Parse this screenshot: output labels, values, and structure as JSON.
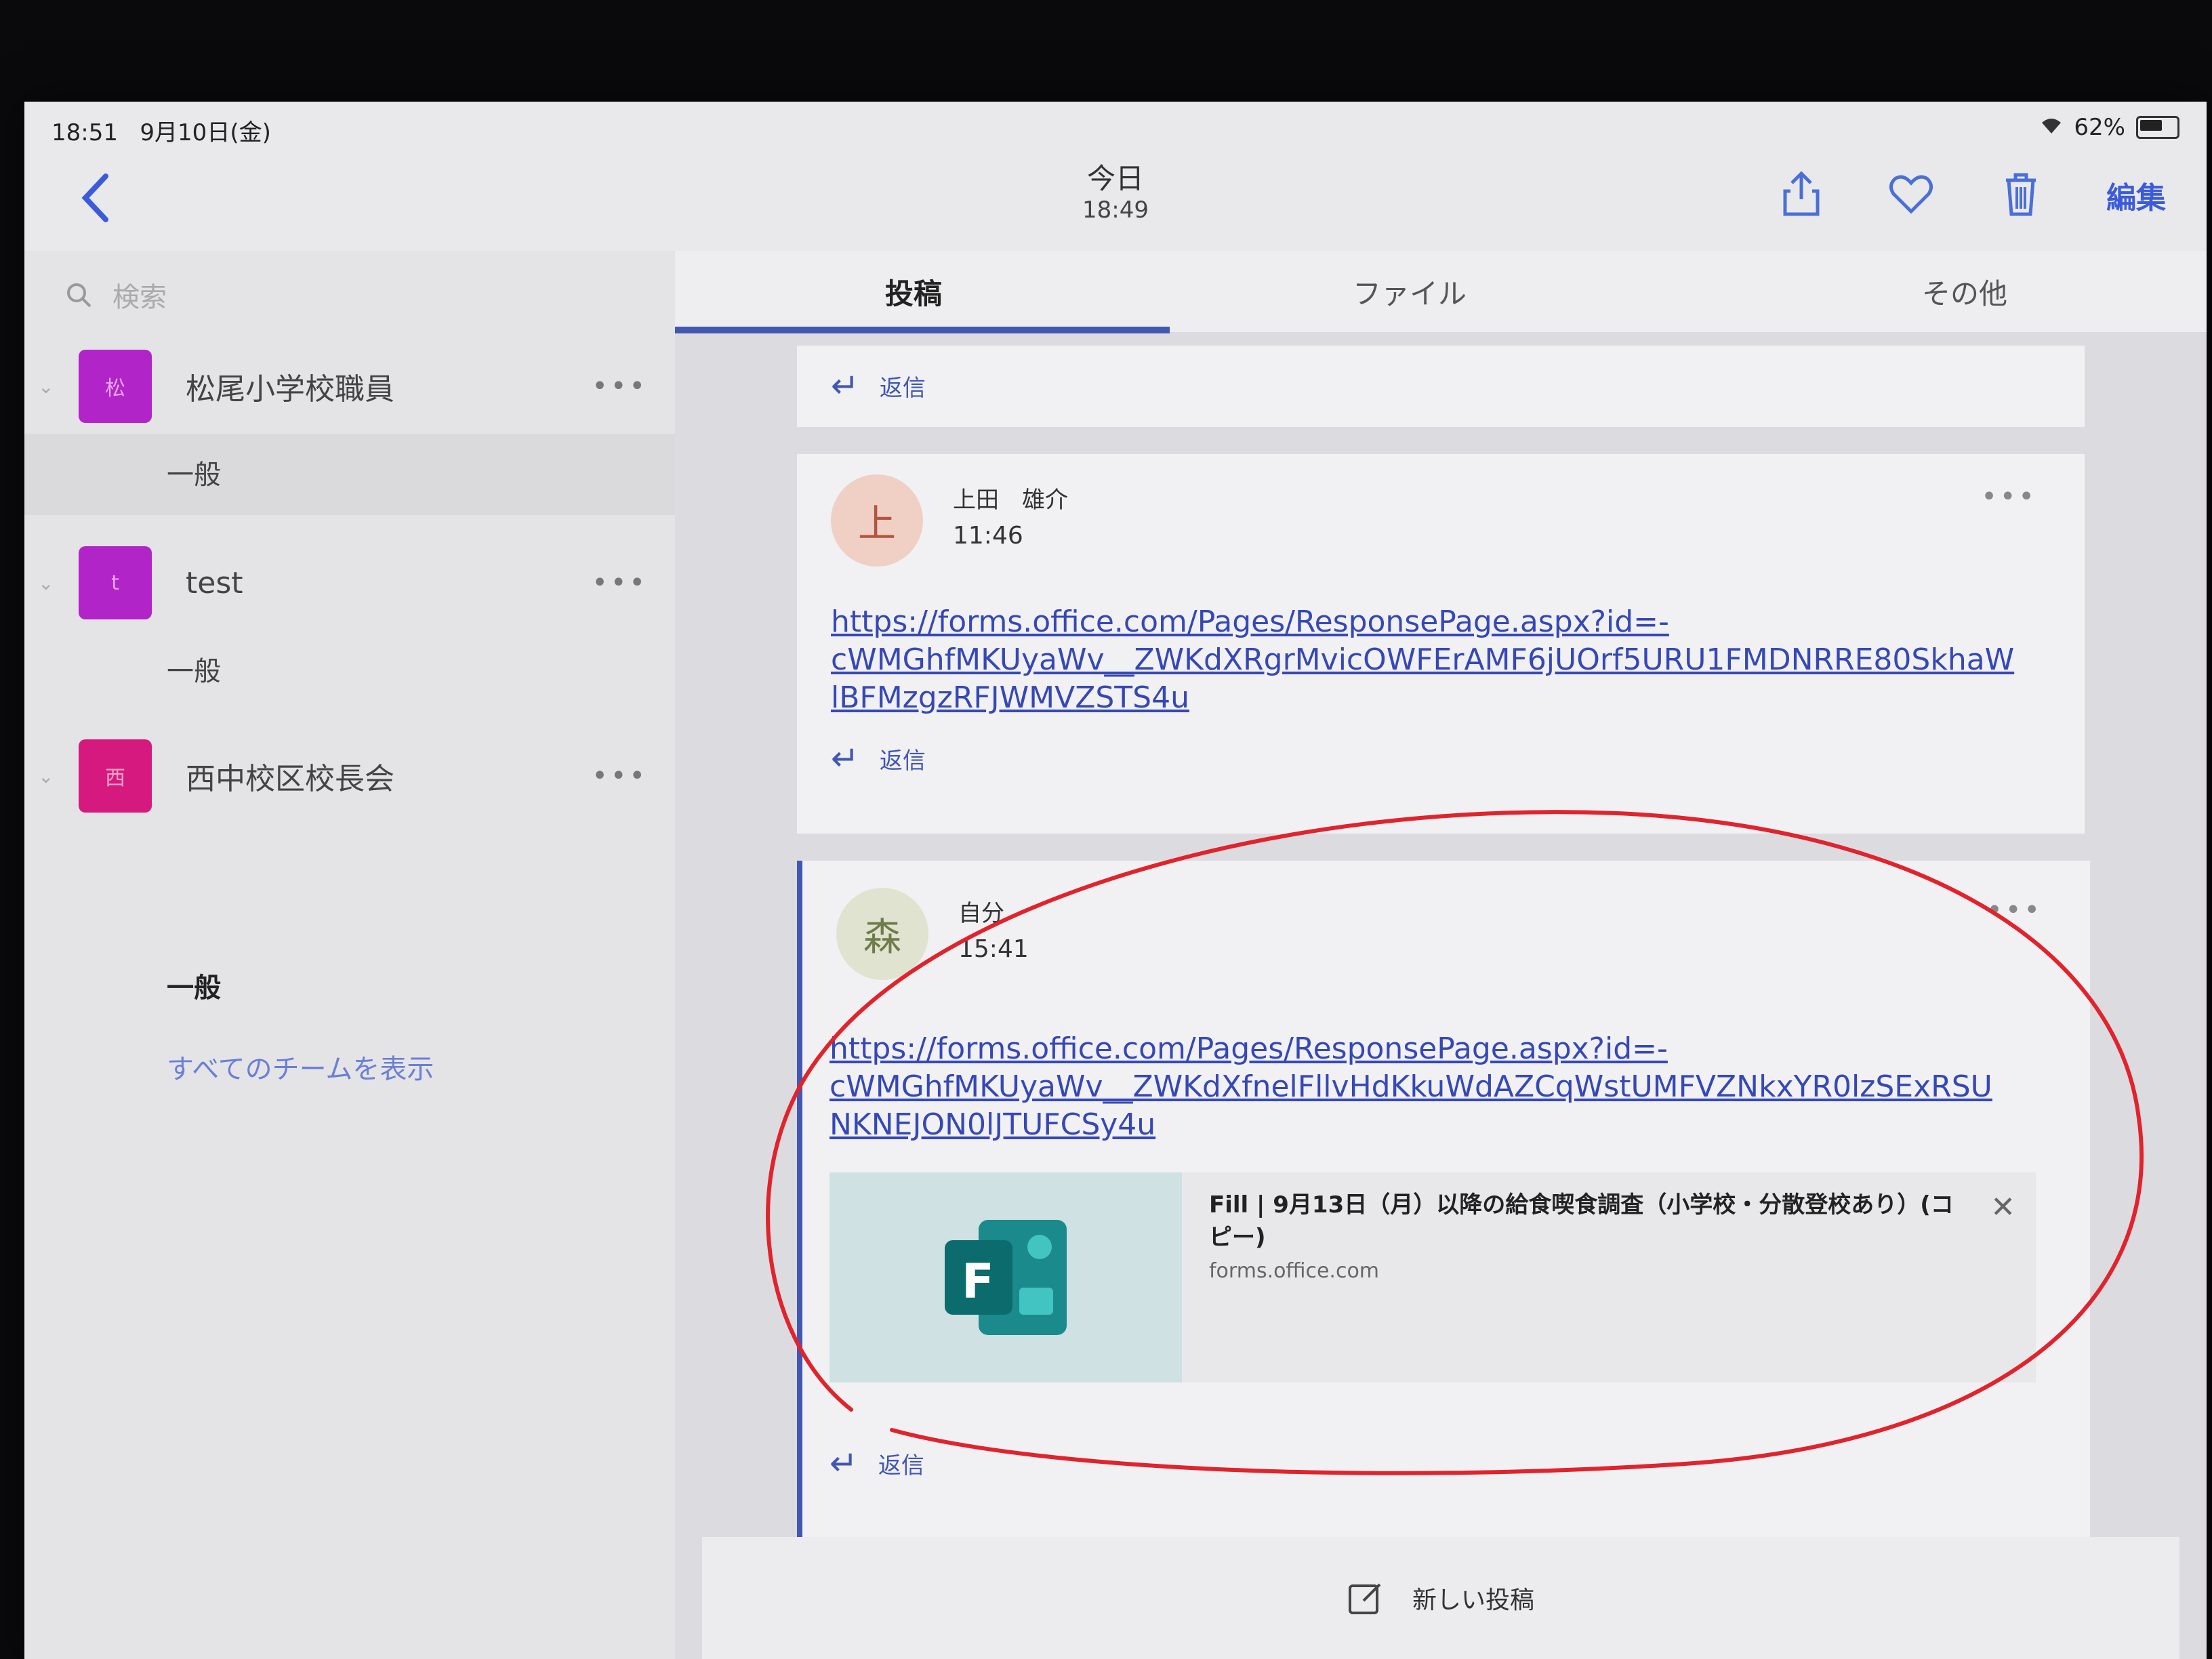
{
  "status": {
    "time": "18:51",
    "date": "9月10日(金)",
    "battery": "62%"
  },
  "nav": {
    "title": "今日",
    "subtitle": "18:49",
    "edit_label": "編集"
  },
  "sidebar": {
    "search_placeholder": "検索",
    "teams": [
      {
        "name": "松尾小学校職員",
        "avatar": "松",
        "channel": "一般"
      },
      {
        "name": "test",
        "avatar": "t",
        "channel": "一般"
      },
      {
        "name": "西中校区校長会",
        "avatar": "西",
        "channel": "一般"
      }
    ],
    "show_all": "すべてのチームを表示"
  },
  "tabs": [
    "投稿",
    "ファイル",
    "その他"
  ],
  "reply_label": "返信",
  "messages": [
    {
      "author": "上田　雄介",
      "avatar": "上",
      "time": "11:46",
      "link_lines": [
        "https://forms.office.com/Pages/ResponsePage.aspx?id=-",
        "cWMGhfMKUyaWv__ZWKdXRgrMvicOWFErAMF6jUOrf5URU1FMDNRRE80SkhaW",
        "lBFMzgzRFJWMVZSTS4u"
      ]
    },
    {
      "author": "自分",
      "avatar": "森",
      "time": "15:41",
      "link_lines": [
        "https://forms.office.com/Pages/ResponsePage.aspx?id=-",
        "cWMGhfMKUyaWv__ZWKdXfnelFllvHdKkuWdAZCqWstUMFVZNkxYR0lzSExRSU",
        "NKNEJON0lJTUFCSy4u"
      ],
      "preview": {
        "title": "Fill | 9月13日（月）以降の給食喫食調査（小学校・分散登校あり）(コピー)",
        "domain": "forms.office.com"
      }
    }
  ],
  "new_post_label": "新しい投稿"
}
